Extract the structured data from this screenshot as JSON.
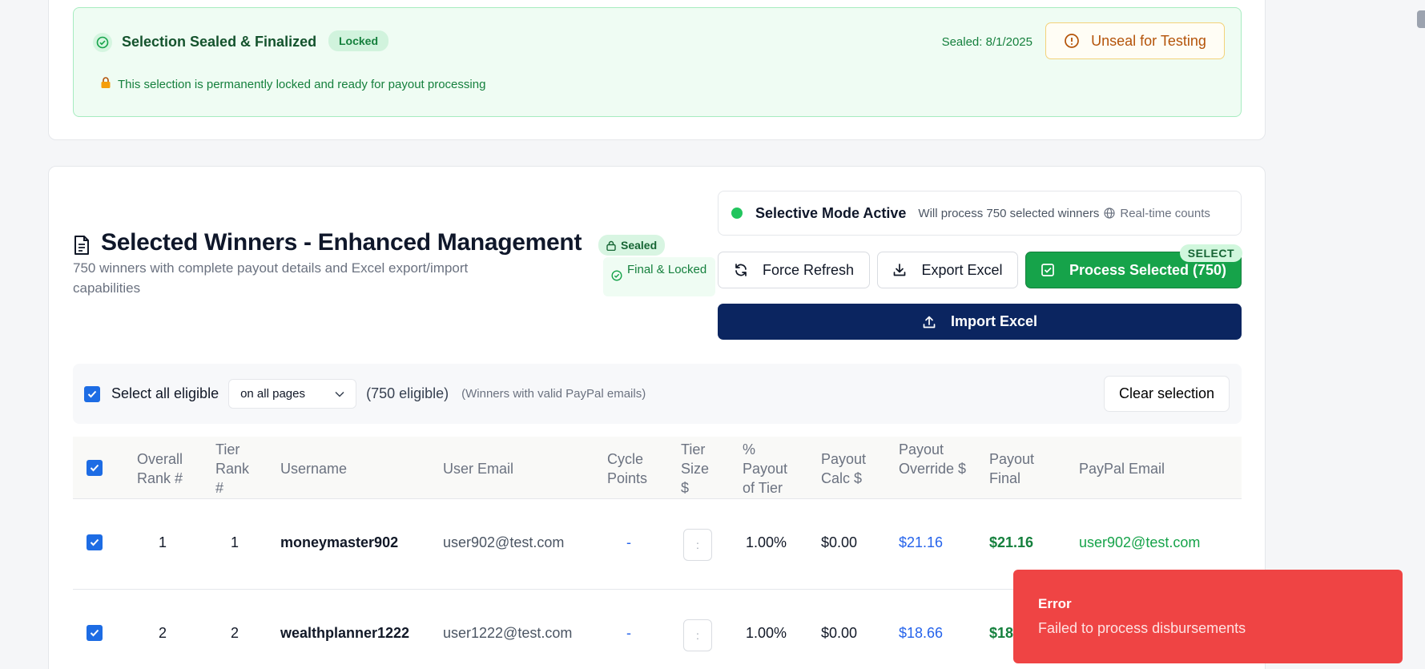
{
  "sealed": {
    "title": "Selection Sealed & Finalized",
    "locked_badge": "Locked",
    "sealed_date": "Sealed: 8/1/2025",
    "unseal_label": "Unseal for Testing",
    "note": "This selection is permanently locked and ready for payout processing"
  },
  "winners": {
    "title": "Selected Winners - Enhanced Management",
    "subtitle": "750 winners with complete payout details and Excel export/import capabilities",
    "sealed_badge": "Sealed",
    "final_badge": "Final & Locked"
  },
  "mode": {
    "title": "Selective Mode Active",
    "text": "Will process 750 selected winners",
    "realtime": "Real-time counts"
  },
  "actions": {
    "refresh": "Force Refresh",
    "export": "Export Excel",
    "process": "Process Selected (750)",
    "select_tag": "SELECT",
    "import": "Import Excel"
  },
  "selection": {
    "label": "Select all eligible",
    "dropdown_value": "on all pages",
    "eligible": "(750 eligible)",
    "hint": "(Winners with valid PayPal emails)",
    "clear": "Clear selection"
  },
  "table": {
    "columns": [
      "Overall Rank #",
      "Tier Rank #",
      "Username",
      "User Email",
      "Cycle Points",
      "Tier Size $",
      "% Payout of Tier",
      "Payout Calc $",
      "Payout Override $",
      "Payout Final",
      "PayPal Email"
    ],
    "rows": [
      {
        "overall": "1",
        "tier": "1",
        "username": "moneymaster902",
        "email": "user902@test.com",
        "points": "-",
        "tier_size": ":",
        "pct": "1.00%",
        "calc": "$0.00",
        "override": "$21.16",
        "final": "$21.16",
        "paypal": "user902@test.com"
      },
      {
        "overall": "2",
        "tier": "2",
        "username": "wealthplanner1222",
        "email": "user1222@test.com",
        "points": "-",
        "tier_size": ":",
        "pct": "1.00%",
        "calc": "$0.00",
        "override": "$18.66",
        "final": "$18",
        "paypal": ""
      }
    ]
  },
  "toast": {
    "title": "Error",
    "message": "Failed to process disbursements"
  },
  "colors": {
    "green": "#16a34a",
    "navy": "#0b2560",
    "error": "#ef4444",
    "link_blue": "#2563eb"
  }
}
